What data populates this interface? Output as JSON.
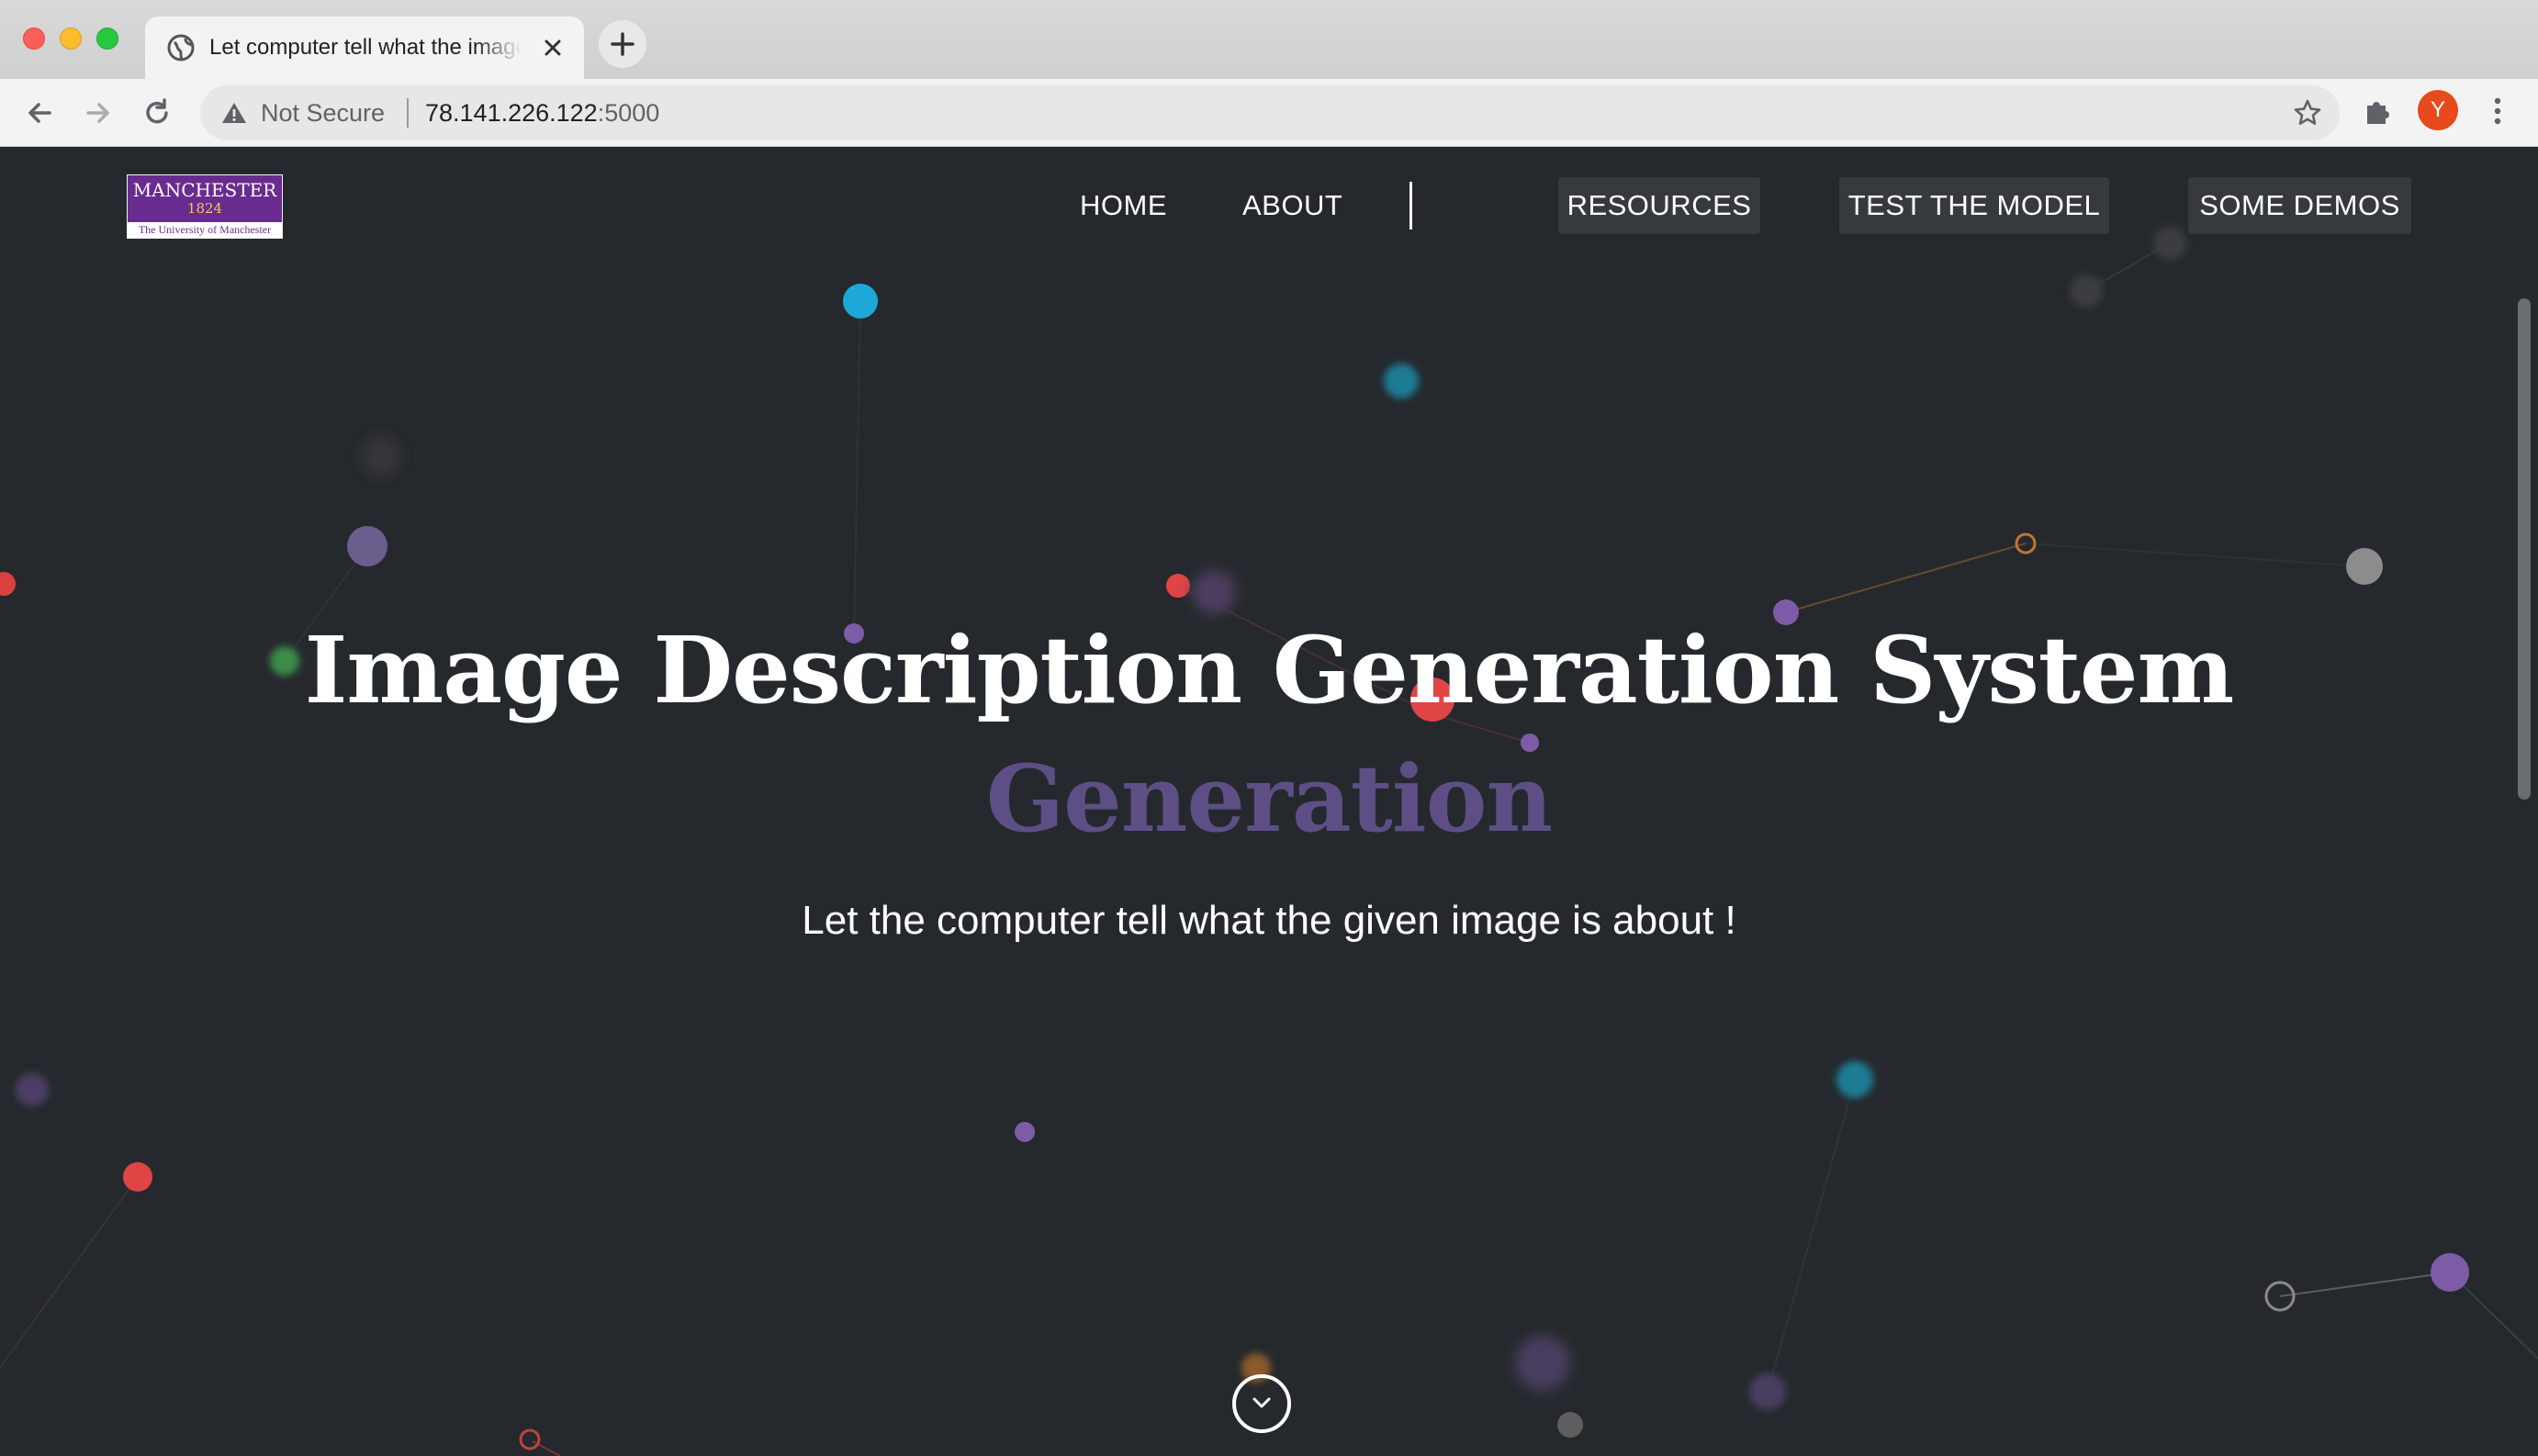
{
  "browser": {
    "tab_title": "Let computer tell what the image is about",
    "address_warning": "Not Secure",
    "url_host": "78.141.226.122",
    "url_port": ":5000",
    "profile_initial": "Y",
    "icons": [
      "close-icon",
      "plus-icon",
      "back-icon",
      "forward-icon",
      "reload-icon",
      "warning-icon",
      "star-icon",
      "puzzle-icon",
      "kebab-menu-icon",
      "globe-icon"
    ]
  },
  "logo": {
    "name": "MANCHESTER",
    "year": "1824",
    "subtitle": "The University of Manchester",
    "color": "#6a2b8f"
  },
  "nav": {
    "home": "HOME",
    "about": "ABOUT",
    "resources": "RESOURCES",
    "test_model": "TEST THE MODEL",
    "demos": "SOME DEMOS"
  },
  "hero": {
    "title": "Image Description Generation System",
    "highlight": "Generation",
    "highlight_color": "#5d4f86",
    "subtitle": "Let the computer tell what the given image is about !"
  },
  "scroll_down_icon": "chevron-down-circle-icon",
  "particle_colors": [
    "#1ea7d9",
    "#e04545",
    "#7e5ba6",
    "#3f9a4e",
    "#9a9a9a",
    "#c4742e"
  ]
}
